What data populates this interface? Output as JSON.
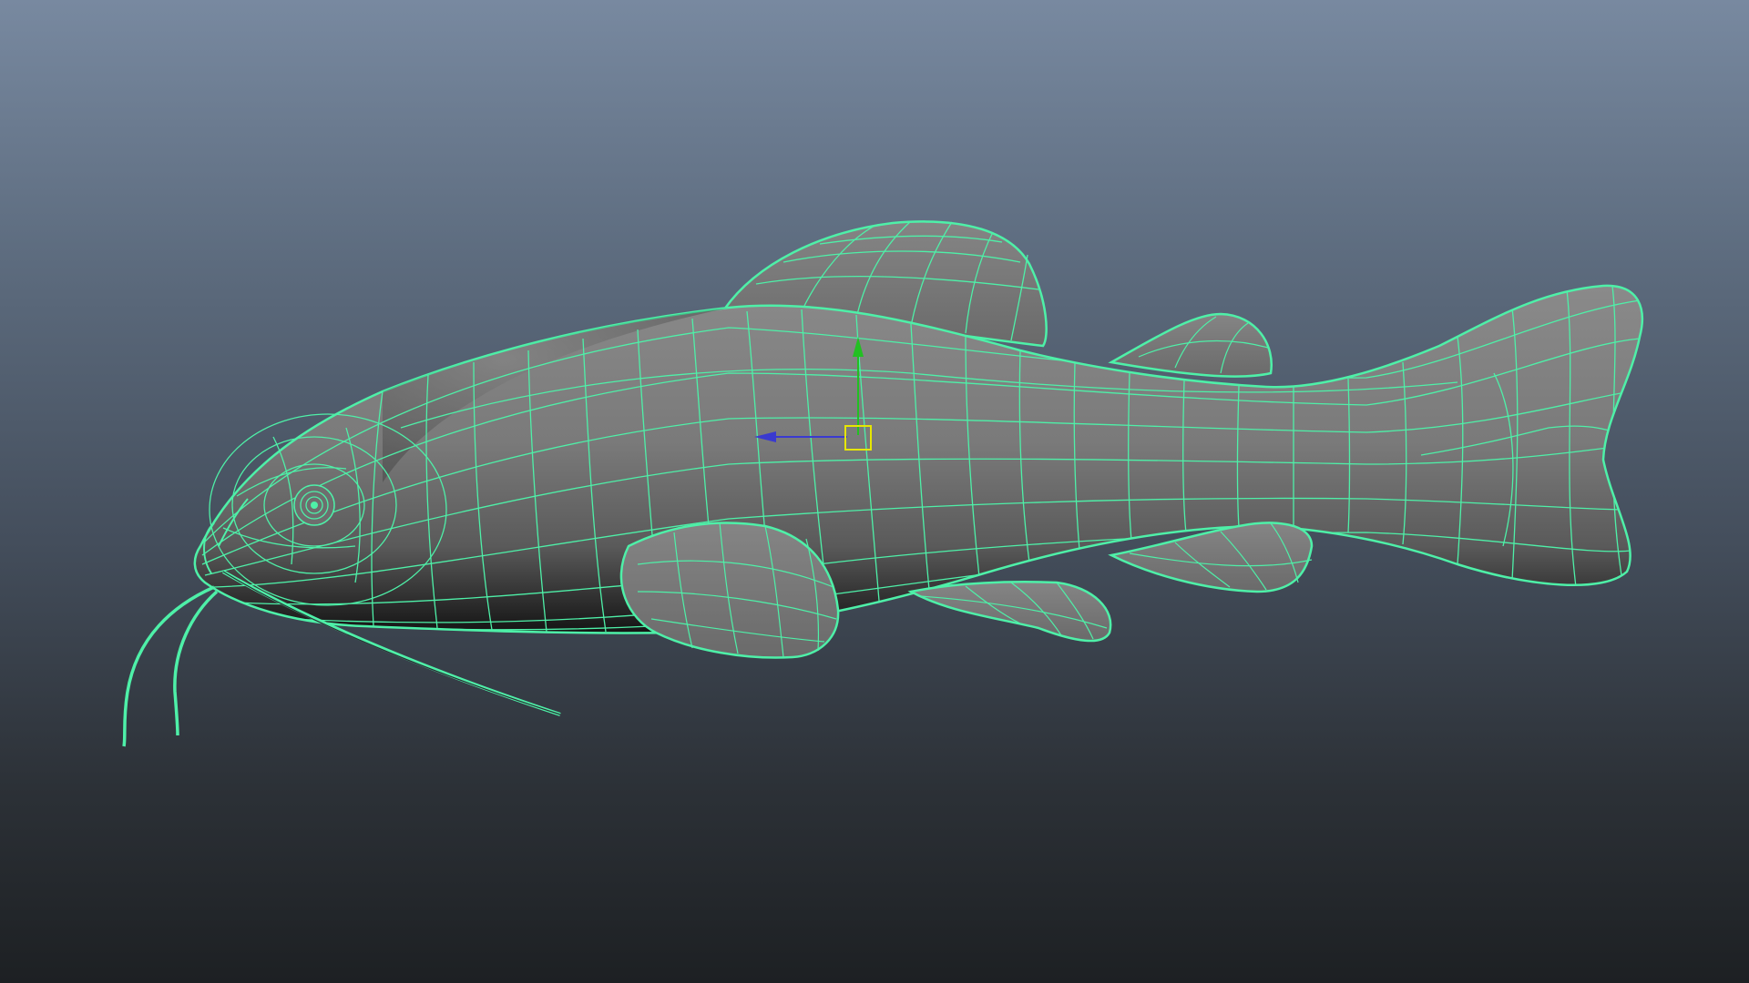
{
  "viewport": {
    "mode": "wireframe-on-shaded",
    "selected_object": "catfish",
    "colors": {
      "background_top": "#7889a0",
      "background_bottom": "#1d2023",
      "mesh_fill": "#7a7a7a",
      "mesh_shadow": "#1a1a1a",
      "wireframe": "#4ef0a8",
      "manipulator_x": "#3a3ad0",
      "manipulator_y": "#22c022",
      "manipulator_center": "#e6e600"
    }
  },
  "manipulator": {
    "tool": "move",
    "icons": [
      "move-manipulator-icon",
      "x-axis-arrow-icon",
      "y-axis-arrow-icon",
      "pivot-handle-icon"
    ]
  }
}
